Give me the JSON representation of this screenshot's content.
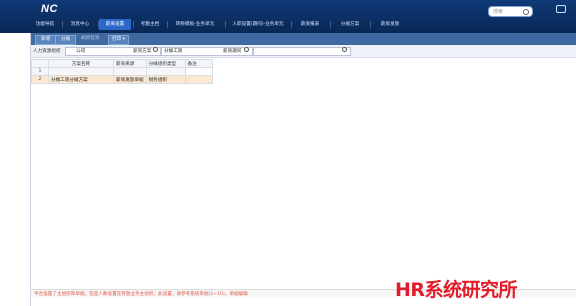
{
  "app": {
    "logo": "NC"
  },
  "search": {
    "placeholder": "搜索"
  },
  "nav": {
    "tabs": [
      {
        "label": "功能导航",
        "active": false
      },
      {
        "label": "消息中心",
        "active": false
      },
      {
        "label": "薪资设置",
        "active": true
      },
      {
        "label": "考勤主档",
        "active": false
      },
      {
        "label": "转移模板-业务单元",
        "active": false
      },
      {
        "label": "入职设置(期间)-业务单元",
        "active": false
      },
      {
        "label": "薪资报表",
        "active": false
      },
      {
        "label": "分摊方案",
        "active": false
      },
      {
        "label": "薪资发放",
        "active": false
      }
    ]
  },
  "toolbar": {
    "new_label": "新增",
    "edit_label": "分摊",
    "refresh_label": "刷新检测",
    "print_label": "打印"
  },
  "filter": {
    "org_label": "人力资源组织",
    "org_value": "公司",
    "scheme_label": "薪资方案",
    "scheme_value": "分摊工资",
    "period_label": "薪资期间"
  },
  "grid": {
    "columns": [
      "",
      "方案名称",
      "薪资来源",
      "分摊组织类型",
      "备注"
    ],
    "rows": [
      {
        "num": "1",
        "name": "",
        "source": "",
        "type": "",
        "note": ""
      },
      {
        "num": "2",
        "name": "分摊工资分摊方案",
        "source": "薪资发放单据",
        "type": "财务组织",
        "note": ""
      }
    ]
  },
  "status": {
    "message": "平台设置了主组织和单据，在是人数设置在存放业务主组织；此设置，请参考系统单据(1~10)，单据编辑"
  },
  "watermark": "HR系统研究所",
  "colors": {
    "topbar": "#0b2d5f",
    "accent": "#2a67c9",
    "selected_row": "#fde8cf",
    "watermark": "#e31c2b"
  }
}
